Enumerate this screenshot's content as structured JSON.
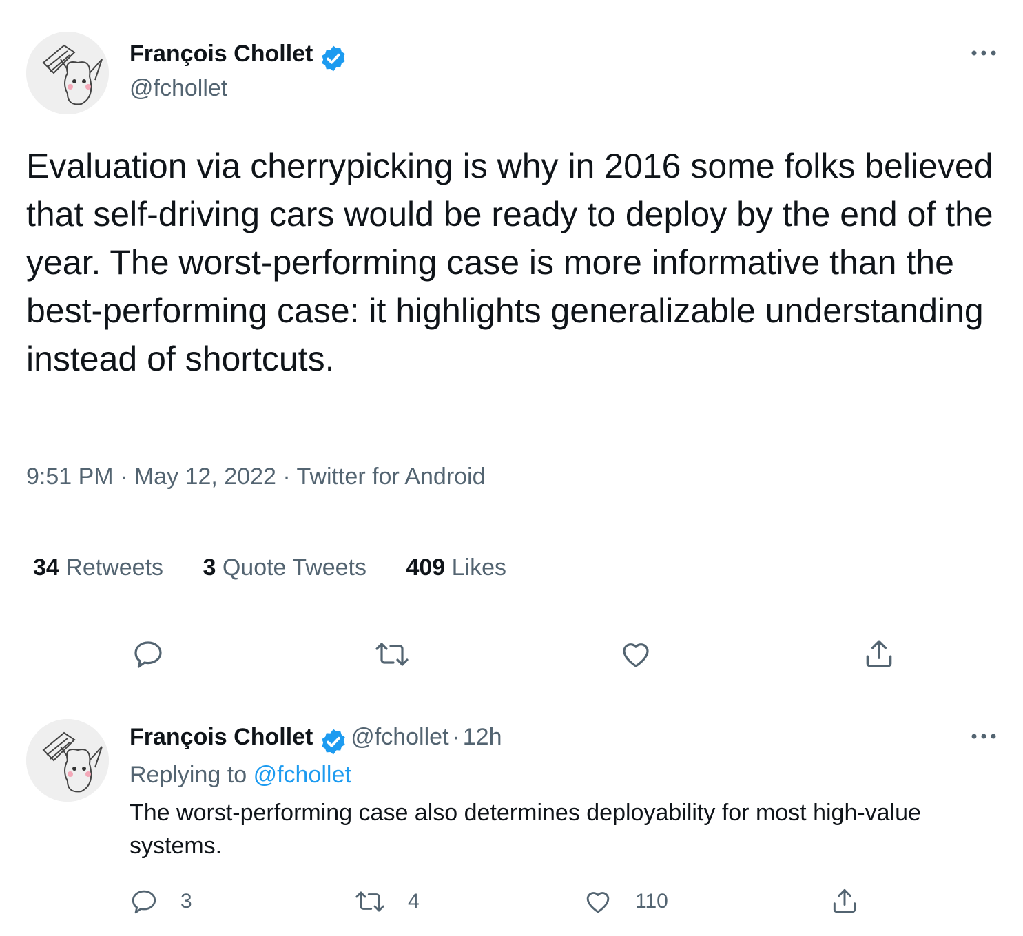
{
  "main_tweet": {
    "author_name": "François Chollet",
    "author_handle": "@fchollet",
    "text": "Evaluation via cherrypicking is why in 2016 some folks believed that self-driving cars would be ready to deploy by the end of the year. The worst-performing case is more informative than the best-performing case: it highlights generalizable understanding instead of shortcuts.",
    "time": "9:51 PM",
    "date": "May 12, 2022",
    "source": "Twitter for Android",
    "separator": "·",
    "stats": {
      "retweets_count": "34",
      "retweets_label": "Retweets",
      "quotes_count": "3",
      "quotes_label": "Quote Tweets",
      "likes_count": "409",
      "likes_label": "Likes"
    },
    "actions": [
      "reply-icon",
      "retweet-icon",
      "like-icon",
      "share-icon"
    ]
  },
  "reply_tweet": {
    "author_name": "François Chollet",
    "author_handle": "@fchollet",
    "time_ago": "12h",
    "separator": "·",
    "replying_to_label": "Replying to",
    "replying_to_handle": "@fchollet",
    "text": "The worst-performing case also determines deployability for most high-value systems.",
    "reply_count": "3",
    "retweet_count": "4",
    "like_count": "110"
  },
  "colors": {
    "verified": "#1d9bf0",
    "link": "#1d9bf0",
    "secondary_text": "#536471",
    "divider": "#eff3f4"
  }
}
